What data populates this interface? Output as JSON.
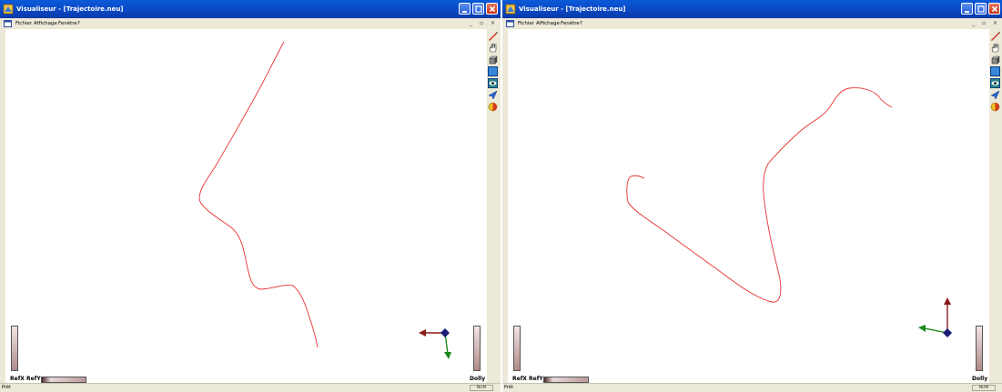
{
  "windows": [
    {
      "title": "Visualiseur - [Trajectoire.neu]",
      "menu": [
        "Fichier",
        "Affichage",
        "Fenêtre",
        "?"
      ],
      "labels": {
        "slider_left": "RefX RefY",
        "slider_right": "Dolly"
      },
      "status": {
        "text": "Prêt",
        "num": "NUM"
      }
    },
    {
      "title": "Visualiseur - [Trajectoire.neu]",
      "menu": [
        "Fichier",
        "Affichage",
        "Fenêtre",
        "?"
      ],
      "labels": {
        "slider_left": "RefX RefY",
        "slider_right": "Dolly"
      },
      "status": {
        "text": "Prêt",
        "num": "NUM"
      }
    }
  ],
  "toolbar_icons": [
    "pencil-icon",
    "hand-pan-icon",
    "rotate-icon",
    "zoom-box-icon",
    "eye-view-icon",
    "fly-icon",
    "shading-icon"
  ],
  "colors": {
    "trajectory": "#e63232",
    "titlebar": "#0b46c2",
    "axis_red": "#8b1a1a",
    "axis_green": "#1a8a1a",
    "axis_blue": "#1c1c7a"
  }
}
